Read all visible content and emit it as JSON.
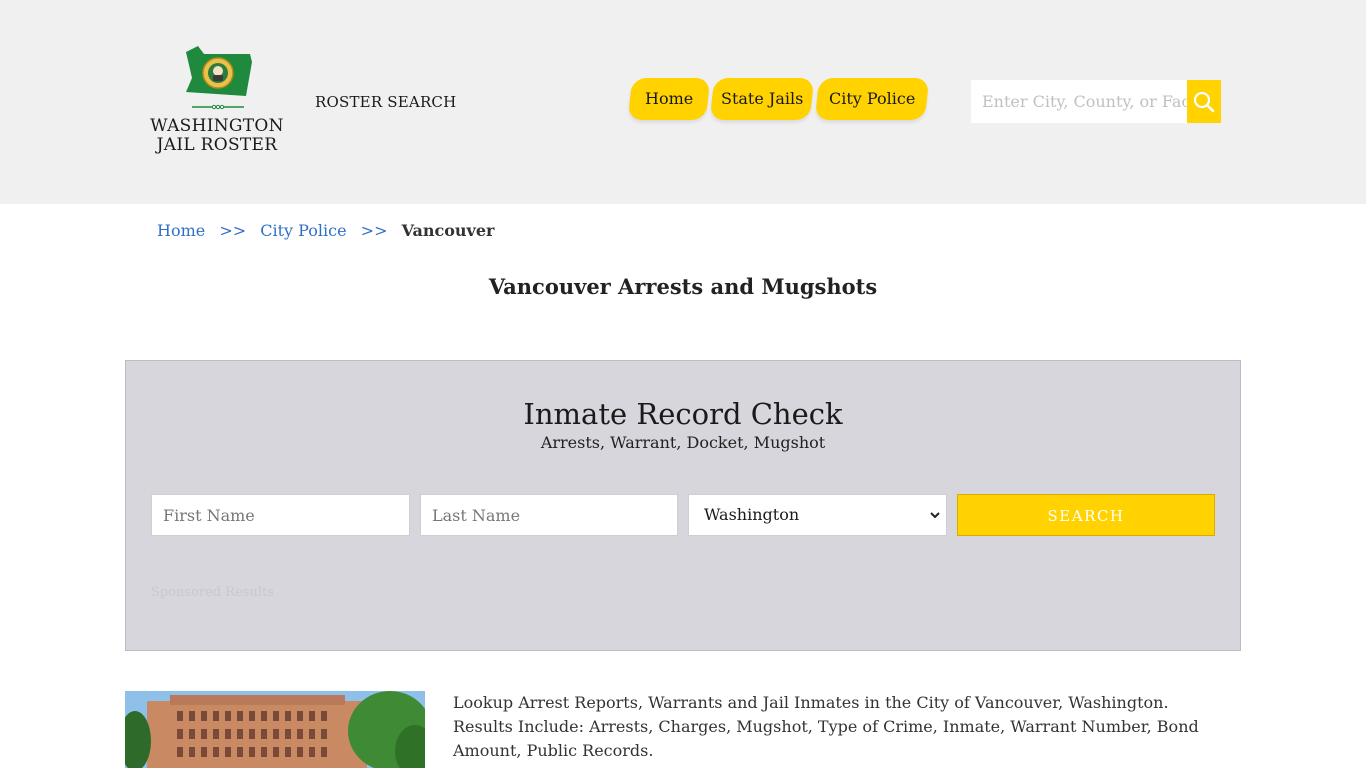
{
  "header": {
    "logo": {
      "line1": "WASHINGTON",
      "line2": "JAIL ROSTER"
    },
    "roster_search": "ROSTER SEARCH",
    "nav": [
      {
        "label": "Home"
      },
      {
        "label": "State Jails"
      },
      {
        "label": "City Police"
      }
    ],
    "search": {
      "placeholder": "Enter City, County, or Facility"
    }
  },
  "breadcrumb": {
    "items": [
      "Home",
      "City Police"
    ],
    "separator": ">>",
    "current": "Vancouver"
  },
  "page_title": "Vancouver Arrests and Mugshots",
  "record_check": {
    "title": "Inmate Record Check",
    "subtitle": "Arrests, Warrant, Docket, Mugshot",
    "first_name_placeholder": "First Name",
    "last_name_placeholder": "Last Name",
    "state_selected": "Washington",
    "search_label": "SEARCH",
    "sponsored": "Sponsored Results"
  },
  "description": "Lookup Arrest Reports, Warrants and Jail Inmates in the City of Vancouver, Washington. Results Include: Arrests, Charges, Mugshot, Type of Crime, Inmate, Warrant Number, Bond Amount, Public Records.",
  "colors": {
    "accent": "#ffd200",
    "header_bg": "#f0f0f0",
    "panel_bg": "#d6d6dc",
    "link": "#2f6fc7",
    "flag_green": "#1f8a3e"
  },
  "icons": {
    "search": "search-icon",
    "chevron": "chevron-down-icon",
    "logo": "washington-state-flag-icon"
  }
}
